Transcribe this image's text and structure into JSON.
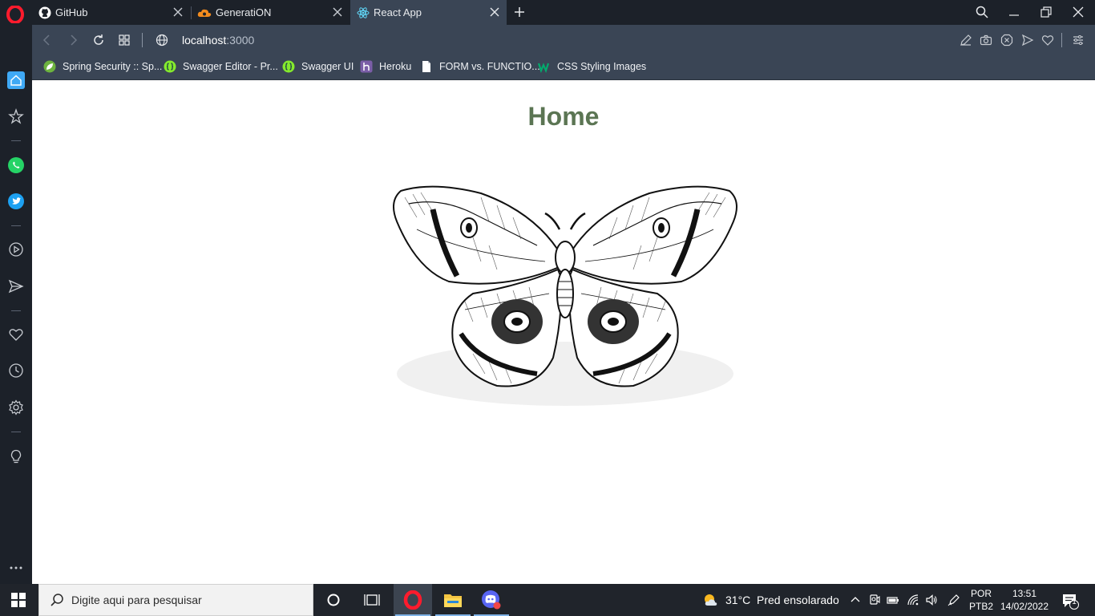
{
  "browser": {
    "tabs": [
      {
        "title": "GitHub",
        "icon": "github-icon",
        "active": false
      },
      {
        "title": "GeneratiON",
        "icon": "cloud-icon",
        "active": false
      },
      {
        "title": "React App",
        "icon": "react-icon",
        "active": true
      }
    ],
    "address": {
      "host": "localhost",
      "port": ":3000"
    },
    "bookmarks": [
      {
        "label": "Spring Security :: Sp...",
        "icon": "spring-leaf-icon"
      },
      {
        "label": "Swagger Editor - Pr...",
        "icon": "swagger-icon"
      },
      {
        "label": "Swagger UI",
        "icon": "swagger-icon"
      },
      {
        "label": "Heroku",
        "icon": "heroku-icon"
      },
      {
        "label": "FORM vs. FUNCTIO...",
        "icon": "document-icon"
      },
      {
        "label": "CSS Styling Images",
        "icon": "w3schools-icon"
      }
    ],
    "accent_color": "#3a4555"
  },
  "page": {
    "title": "Home",
    "title_color": "#5b7553",
    "image": "moth-illustration"
  },
  "taskbar": {
    "search_placeholder": "Digite aqui para pesquisar",
    "weather_temp": "31°C",
    "weather_text": "Pred ensolarado",
    "language_top": "POR",
    "language_bottom": "PTB2",
    "time": "13:51",
    "date": "14/02/2022",
    "notification_count": "1"
  }
}
